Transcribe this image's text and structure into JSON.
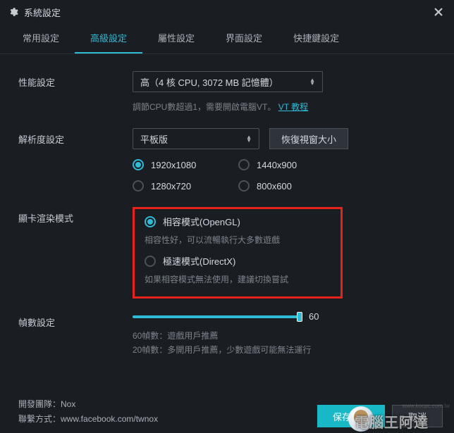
{
  "title": "系統設定",
  "tabs": [
    "常用設定",
    "高級設定",
    "屬性設定",
    "界面設定",
    "快捷鍵設定"
  ],
  "active_tab_index": 1,
  "performance": {
    "label": "性能設定",
    "value": "高（4 核 CPU, 3072 MB 記憶體）",
    "hint_prefix": "調節CPU數超過1，需要開啟電腦VT。",
    "hint_link": "VT 教程"
  },
  "resolution": {
    "label": "解析度設定",
    "mode": "平板版",
    "restore_btn": "恢復視窗大小",
    "options": [
      "1920x1080",
      "1440x900",
      "1280x720",
      "800x600"
    ],
    "selected": "1920x1080"
  },
  "render": {
    "label": "顯卡渲染模式",
    "opengl_label": "相容模式(OpenGL)",
    "opengl_desc": "相容性好，可以流暢執行大多數遊戲",
    "directx_label": "極速模式(DirectX)",
    "directx_desc": "如果相容模式無法使用，建議切換嘗試",
    "selected": "opengl"
  },
  "fps": {
    "label": "幀數設定",
    "value": 60,
    "max": 60,
    "hint_60": "60幀數：遊戲用戶推薦",
    "hint_20": "20幀數：多開用戶推薦，少數遊戲可能無法運行"
  },
  "footer": {
    "team_label": "開發團隊：",
    "team_value": "Nox",
    "contact_label": "聯繫方式：",
    "contact_value": "www.facebook.com/twnox",
    "save": "保存設定",
    "cancel": "取消"
  },
  "watermark": "www.kocpc.com.tw",
  "brand": "電腦王阿達"
}
